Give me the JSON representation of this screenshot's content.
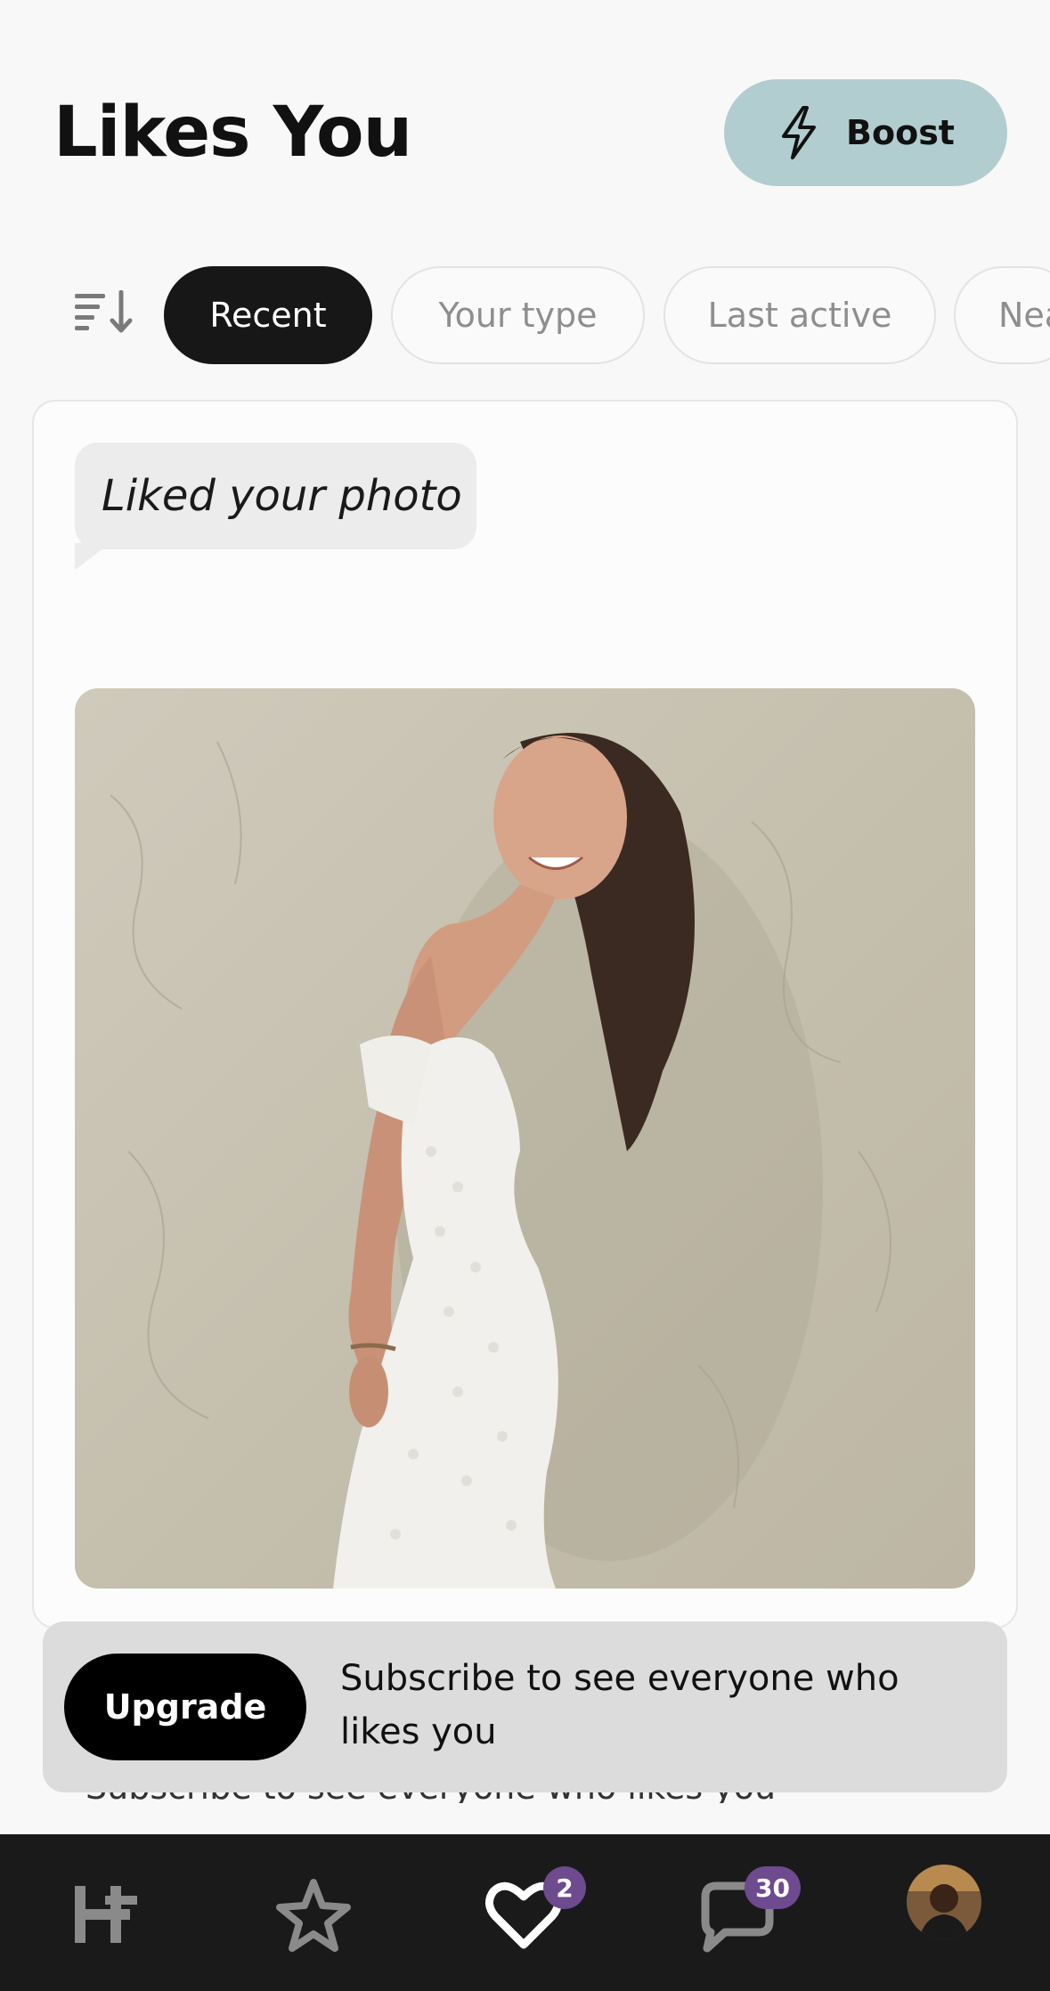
{
  "header": {
    "title": "Likes You",
    "boost_label": "Boost",
    "boost_icon": "lightning-bolt-icon",
    "boost_color": "#b2cdcf"
  },
  "filters": {
    "sort_icon": "sort-descending-icon",
    "chips": [
      {
        "label": "Recent",
        "active": true
      },
      {
        "label": "Your type",
        "active": false
      },
      {
        "label": "Last active",
        "active": false
      },
      {
        "label": "Nea",
        "active": false
      }
    ]
  },
  "card": {
    "comment": "Liked your photo"
  },
  "upgrade": {
    "button_label": "Upgrade",
    "text": "Subscribe to see everyone who likes you",
    "hidden_text": "Subscribe to see everyone who likes you"
  },
  "nav": {
    "items": [
      {
        "icon": "home-h-icon"
      },
      {
        "icon": "star-icon"
      },
      {
        "icon": "heart-icon",
        "badge": "2"
      },
      {
        "icon": "chat-icon",
        "badge": "30"
      },
      {
        "icon": "profile-avatar"
      }
    ],
    "badge_color": "#6e4a8e"
  }
}
